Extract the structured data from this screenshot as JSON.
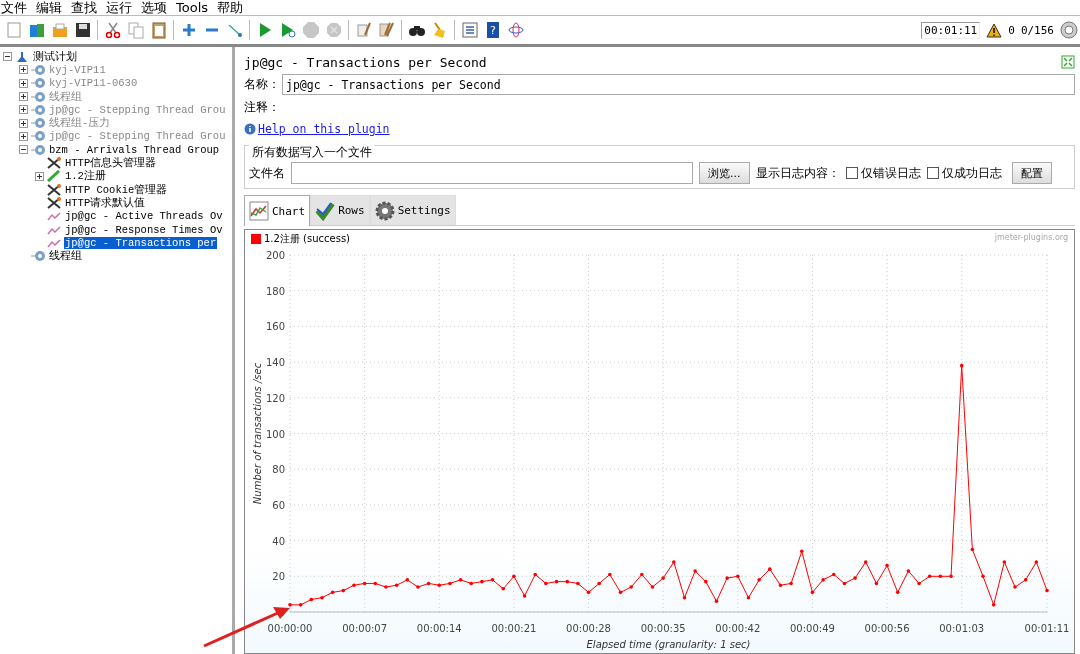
{
  "menu": [
    "文件",
    "编辑",
    "查找",
    "运行",
    "选项",
    "Tools",
    "帮助"
  ],
  "toolbar": [
    {
      "kind": "new",
      "disabled": false
    },
    {
      "kind": "templates",
      "disabled": false
    },
    {
      "kind": "open",
      "disabled": false
    },
    {
      "kind": "save",
      "disabled": false
    },
    {
      "kind": "cut",
      "disabled": false
    },
    {
      "kind": "copy",
      "disabled": false
    },
    {
      "kind": "paste",
      "disabled": false
    },
    {
      "kind": "expand",
      "disabled": false
    },
    {
      "kind": "collapse",
      "disabled": false
    },
    {
      "kind": "toggle",
      "disabled": false
    },
    {
      "kind": "start",
      "disabled": false
    },
    {
      "kind": "start-no-pause",
      "disabled": false
    },
    {
      "kind": "stop",
      "disabled": true
    },
    {
      "kind": "shutdown",
      "disabled": true
    },
    {
      "kind": "clear",
      "disabled": false
    },
    {
      "kind": "clear-all",
      "disabled": false
    },
    {
      "kind": "search",
      "disabled": false
    },
    {
      "kind": "reset-search",
      "disabled": false
    },
    {
      "kind": "functions",
      "disabled": false
    },
    {
      "kind": "help",
      "glyph": "?",
      "disabled": false
    },
    {
      "kind": "remote",
      "disabled": false
    }
  ],
  "status": {
    "timer": "00:01:11",
    "warnings": "0",
    "threads": "0/156"
  },
  "tree": {
    "label": "测试计划",
    "kind": "plan",
    "expanded": true,
    "selected": false,
    "disabled": false,
    "children": [
      {
        "label": "kyj-VIP11",
        "kind": "thread-group",
        "expanded": false,
        "selected": false,
        "disabled": true
      },
      {
        "label": "kyj-VIP11-0630",
        "kind": "thread-group",
        "expanded": false,
        "selected": false,
        "disabled": true
      },
      {
        "label": "线程组",
        "kind": "thread-group",
        "expanded": false,
        "selected": false,
        "disabled": true
      },
      {
        "label": "jp@gc - Stepping Thread Grou",
        "kind": "thread-group",
        "expanded": false,
        "selected": false,
        "disabled": true
      },
      {
        "label": "线程组-压力",
        "kind": "thread-group",
        "expanded": false,
        "selected": false,
        "disabled": true
      },
      {
        "label": "jp@gc - Stepping Thread Grou",
        "kind": "thread-group",
        "expanded": false,
        "selected": false,
        "disabled": true
      },
      {
        "label": "bzm - Arrivals Thread Group",
        "kind": "thread-group",
        "expanded": true,
        "selected": false,
        "disabled": false,
        "children": [
          {
            "label": "HTTP信息头管理器",
            "kind": "config",
            "selected": false,
            "disabled": false
          },
          {
            "label": "1.2注册",
            "kind": "sampler",
            "expanded": false,
            "selected": false,
            "disabled": false
          },
          {
            "label": "HTTP Cookie管理器",
            "kind": "config",
            "selected": false,
            "disabled": false
          },
          {
            "label": "HTTP请求默认值",
            "kind": "config",
            "selected": false,
            "disabled": false
          },
          {
            "label": "jp@gc - Active Threads Ov",
            "kind": "listener",
            "selected": false,
            "disabled": false
          },
          {
            "label": "jp@gc - Response Times Ov",
            "kind": "listener",
            "selected": false,
            "disabled": false
          },
          {
            "label": "jp@gc - Transactions per",
            "kind": "listener",
            "selected": true,
            "disabled": false
          }
        ]
      },
      {
        "label": "线程组",
        "kind": "thread-group",
        "selected": false,
        "disabled": false
      }
    ]
  },
  "panel": {
    "title": "jp@gc - Transactions per Second",
    "name_label": "名称：",
    "name_value": "jp@gc - Transactions per Second",
    "comment_label": "注释：",
    "help_link": "Help on this plugin",
    "file_group": {
      "legend": "所有数据写入一个文件",
      "filename_label": "文件名",
      "browse": "浏览...",
      "log_label": "显示日志内容：",
      "checkboxes": [
        {
          "label": "仅错误日志",
          "checked": false
        },
        {
          "label": "仅成功日志",
          "checked": false
        }
      ],
      "configure": "配置"
    },
    "tabs": [
      {
        "label": "Chart",
        "kind": "chart",
        "selected": true
      },
      {
        "label": "Rows",
        "kind": "rows",
        "selected": false
      },
      {
        "label": "Settings",
        "kind": "settings",
        "selected": false
      }
    ],
    "credit": "jmeter-plugins.org",
    "chart_data": {
      "type": "line",
      "grid": true,
      "xlabel": "Elapsed time (granularity: 1 sec)",
      "ylabel": "Number of transactions /sec",
      "x": [
        0,
        1,
        2,
        3,
        4,
        5,
        6,
        7,
        8,
        9,
        10,
        11,
        12,
        13,
        14,
        15,
        16,
        17,
        18,
        19,
        20,
        21,
        22,
        23,
        24,
        25,
        26,
        27,
        28,
        29,
        30,
        31,
        32,
        33,
        34,
        35,
        36,
        37,
        38,
        39,
        40,
        41,
        42,
        43,
        44,
        45,
        46,
        47,
        48,
        49,
        50,
        51,
        52,
        53,
        54,
        55,
        56,
        57,
        58,
        59,
        60,
        61,
        62,
        63,
        64,
        65,
        66,
        67,
        68,
        69,
        70,
        71
      ],
      "xlim": [
        0,
        71
      ],
      "ylim": [
        0,
        200
      ],
      "xticks": [
        {
          "value": 0,
          "label": "00:00:00"
        },
        {
          "value": 7,
          "label": "00:00:07"
        },
        {
          "value": 14,
          "label": "00:00:14"
        },
        {
          "value": 21,
          "label": "00:00:21"
        },
        {
          "value": 28,
          "label": "00:00:28"
        },
        {
          "value": 35,
          "label": "00:00:35"
        },
        {
          "value": 42,
          "label": "00:00:42"
        },
        {
          "value": 49,
          "label": "00:00:49"
        },
        {
          "value": 56,
          "label": "00:00:56"
        },
        {
          "value": 63,
          "label": "00:01:03"
        },
        {
          "value": 71,
          "label": "00:01:11"
        }
      ],
      "yticks": [
        0,
        20,
        40,
        60,
        80,
        100,
        120,
        140,
        160,
        180,
        200
      ],
      "series": [
        {
          "name": "1.2注册 (success)",
          "color": "#ff0000",
          "values": [
            4,
            4,
            7,
            8,
            11,
            12,
            15,
            16,
            16,
            14,
            15,
            18,
            14,
            16,
            15,
            16,
            18,
            16,
            17,
            18,
            13,
            20,
            9,
            21,
            16,
            17,
            17,
            16,
            11,
            16,
            21,
            11,
            14,
            21,
            14,
            19,
            28,
            8,
            23,
            17,
            6,
            19,
            20,
            8,
            18,
            24,
            15,
            16,
            34,
            11,
            18,
            21,
            16,
            19,
            28,
            16,
            26,
            11,
            23,
            16,
            20,
            20,
            20,
            138,
            35,
            20,
            4,
            28,
            14,
            18,
            28,
            12
          ]
        }
      ]
    }
  }
}
